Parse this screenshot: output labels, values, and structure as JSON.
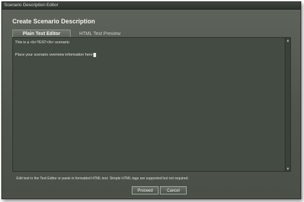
{
  "window": {
    "title": "Scenario Description Editor"
  },
  "header": {
    "title": "Create Scenario Description"
  },
  "tabs": [
    {
      "label": "Plain Text Editor",
      "active": true
    },
    {
      "label": "HTML Text Preview",
      "active": false
    }
  ],
  "editor": {
    "lines": [
      "This is a <b>TEST</b> scenario",
      "Place your scenario overview information here"
    ]
  },
  "hint": "Edit text in the Text Editor or paste in formatted HTML text.  Simple HTML tags are supported but not required.",
  "buttons": {
    "proceed": "Proceed",
    "cancel": "Cancel"
  },
  "colors": {
    "window_bg": "#555b53",
    "editor_bg": "#444b42",
    "text": "#e8eae4"
  },
  "icons": {
    "scroll_up": "triangle-up-icon",
    "scroll_down": "triangle-down-icon"
  }
}
